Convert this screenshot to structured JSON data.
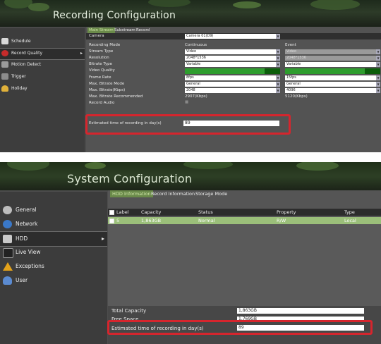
{
  "recording": {
    "title": "Recording Configuration",
    "sidebar": [
      {
        "label": "Schedule",
        "icon": "calendar-icon"
      },
      {
        "label": "Record Quality",
        "icon": "record-icon"
      },
      {
        "label": "Motion Detect",
        "icon": "motion-icon"
      },
      {
        "label": "Trigger",
        "icon": "trigger-icon"
      },
      {
        "label": "Holiday",
        "icon": "holiday-icon"
      }
    ],
    "tabs": [
      "Main Stream",
      "Substream",
      "Record"
    ],
    "camera_label": "Camera",
    "camera_value": "Camera 01(D9)",
    "columns": {
      "mode": "Recording Mode",
      "continuous": "Continuous",
      "event": "Event"
    },
    "rows": [
      {
        "label": "Stream Type",
        "cont": "Video",
        "event": "Video"
      },
      {
        "label": "Resolution",
        "cont": "2048*1536",
        "event": "2048*1536"
      },
      {
        "label": "Bitrate Type",
        "cont": "Variable",
        "event": "Variable"
      },
      {
        "label": "Video Quality",
        "cont": "",
        "event": ""
      },
      {
        "label": "Frame Rate",
        "cont": "8fps",
        "event": "15fps"
      },
      {
        "label": "Max. Bitrate Mode",
        "cont": "General",
        "event": "General"
      },
      {
        "label": "Max. Bitrate(Kbps)",
        "cont": "2048",
        "event": "4096"
      },
      {
        "label": "Max. Bitrate Recommended",
        "cont": "2907(Kbps)",
        "event": "5120(Kbps)"
      },
      {
        "label": "Record Audio",
        "cont": "",
        "event": ""
      }
    ],
    "estimated_label": "Estimated time of recording in day(s)",
    "estimated_value": "89"
  },
  "system": {
    "title": "System Configuration",
    "sidebar": [
      {
        "label": "General",
        "icon": "gear-icon"
      },
      {
        "label": "Network",
        "icon": "network-icon"
      },
      {
        "label": "HDD",
        "icon": "hdd-icon"
      },
      {
        "label": "Live View",
        "icon": "monitor-icon"
      },
      {
        "label": "Exceptions",
        "icon": "warning-icon"
      },
      {
        "label": "User",
        "icon": "user-icon"
      }
    ],
    "tabs": [
      "HDD Information",
      "Record Information",
      "Storage Mode"
    ],
    "table": {
      "headers": [
        "Label",
        "Capacity",
        "Status",
        "Property",
        "Type"
      ],
      "rows": [
        [
          "5",
          "1,863GB",
          "Normal",
          "R/W",
          "Local"
        ]
      ]
    },
    "footer": {
      "total_capacity_label": "Total Capacity",
      "total_capacity_value": "1,863GB",
      "free_space_label": "Free Space",
      "free_space_value": "1,769GB",
      "estimated_label": "Estimated time of recording in day(s)",
      "estimated_value": "89"
    }
  }
}
